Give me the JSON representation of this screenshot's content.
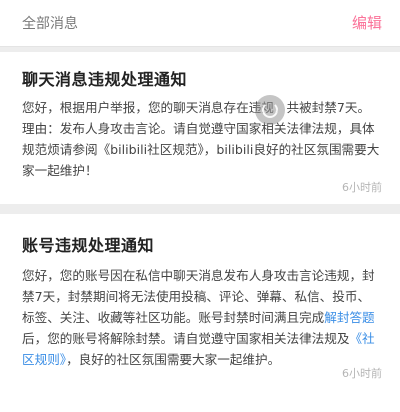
{
  "header": {
    "title": "全部消息",
    "edit_label": "编辑"
  },
  "messages": [
    {
      "title": "聊天消息违规处理通知",
      "body": "您好，根据用户举报，您的聊天消息存在违规，共被封禁7天。理由：发布人身攻击言论。请自觉遵守国家相关法律法规，具体规范烦请参阅《bilibili社区规范》，bilibili良好的社区氛围需要大家一起维护！",
      "time": "6小时前"
    },
    {
      "title": "账号违规处理通知",
      "body_part1": "您好，您的账号因在私信中聊天消息发布人身攻击言论违规，封禁7天，封禁期间将无法使用投稿、评论、弹幕、私信、投币、标签、关注、收藏等社区功能。账号封禁时间满且完成",
      "link1": "解封答题",
      "body_part2": "后，您的账号将解除封禁。请自觉遵守国家相关法律法规及",
      "link2": "《社区规则》",
      "body_part3": "，良好的社区氛围需要大家一起维护。",
      "time": "6小时前"
    }
  ],
  "colors": {
    "accent": "#fb7299",
    "link": "#3a8ee6"
  }
}
